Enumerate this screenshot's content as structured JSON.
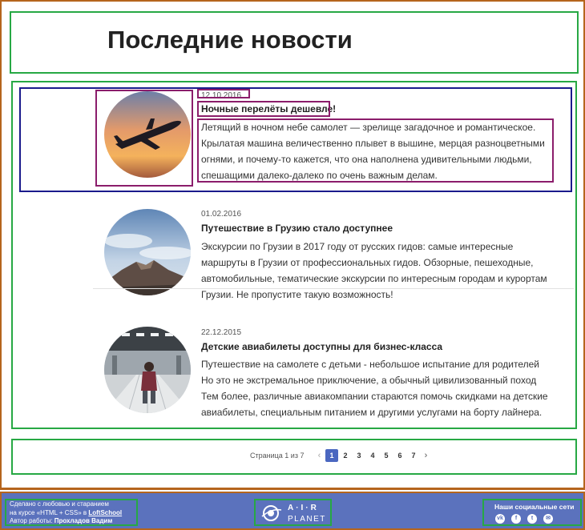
{
  "page": {
    "title": "Последние новости"
  },
  "articles": [
    {
      "date": "12.10.2016",
      "title": "Ночные перелёты дешевле!",
      "text": "Летящий в ночном небе самолет — зрелище загадочное и романтическое. Крылатая машина величественно плывет в вышине, мерцая разноцветными огнями, и почему-то кажется, что она наполнена удивительными людьми, спешащими далеко-далеко по очень важным делам.",
      "image": "airplane-sunset"
    },
    {
      "date": "01.02.2016",
      "title": "Путешествие в Грузию стало доступнее",
      "text": "Экскурсии по Грузии в 2017 году от русских гидов: самые интересные маршруты в Грузии от профессиональных гидов. Обзорные, пешеходные, автомобильные, тематические экскурсии по интересным городам и курортам Грузии. Не пропустите такую возможность!",
      "image": "mountain-clouds"
    },
    {
      "date": "22.12.2015",
      "title": "Детские авиабилеты доступны для бизнес-класса",
      "text": "Путешествие на самолете с детьми - небольшое испытание для родителей Но это не экстремальное приключение, а обычный цивилизованный поход Тем более, различные авиакомпании стараются помочь скидками на детские авиабилеты, специальным питанием и другими услугами на борту лайнера.",
      "image": "child-airport"
    }
  ],
  "pagination": {
    "label": "Страница 1 из 7",
    "prev": "‹",
    "next": "›",
    "pages": [
      "1",
      "2",
      "3",
      "4",
      "5",
      "6",
      "7"
    ],
    "current": "1"
  },
  "footer": {
    "credit_line1": "Сделано с любовью и старанием",
    "credit_line2_prefix": "на курсе «HTML + CSS» в ",
    "credit_link": "LoftSchool",
    "credit_line3_prefix": "Автор работы: ",
    "credit_author": "Прохладов Вадим",
    "logo_top": "A·I·R",
    "logo_bottom": "PLANET",
    "social_title": "Наши социальные сети",
    "social_icons": [
      "vk-icon",
      "facebook-icon",
      "twitter-icon",
      "email-icon"
    ]
  },
  "colors": {
    "accent": "#4a67c0",
    "footer_bg": "#5b72bd",
    "outline_outer": "#b5651d",
    "outline_section": "#27a844"
  }
}
